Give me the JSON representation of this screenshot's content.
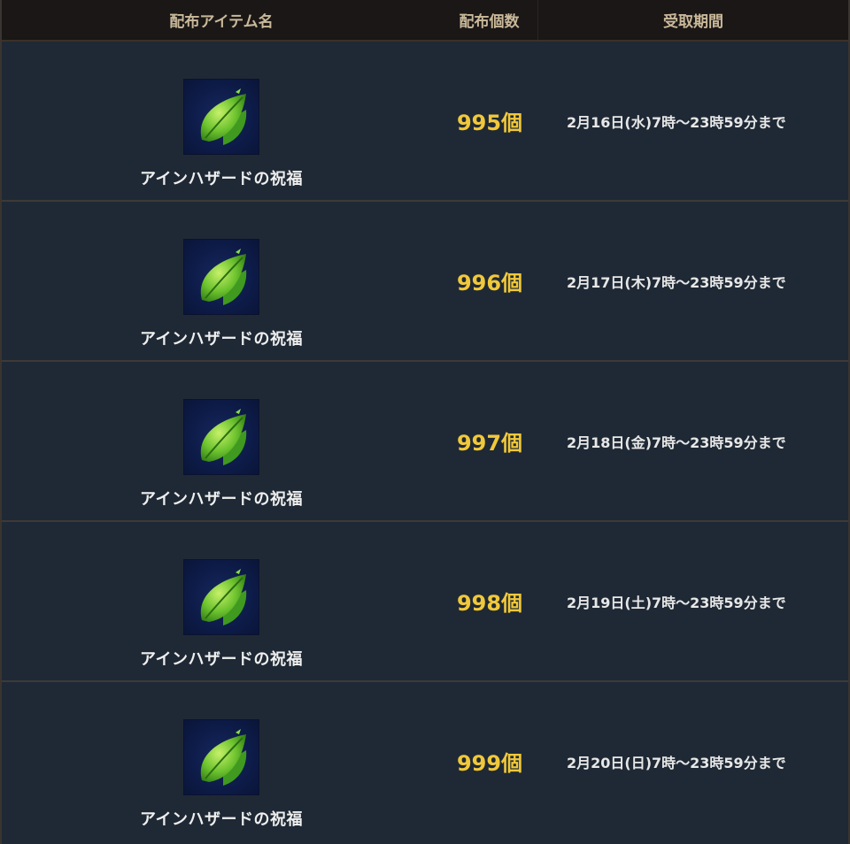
{
  "header": {
    "name_label": "配布アイテム名",
    "qty_label": "配布個数",
    "period_label": "受取期間"
  },
  "rows": [
    {
      "item_name": "アインハザードの祝福",
      "icon": "leaf-icon",
      "quantity": "995個",
      "period": "2月16日(水)7時〜23時59分まで"
    },
    {
      "item_name": "アインハザードの祝福",
      "icon": "leaf-icon",
      "quantity": "996個",
      "period": "2月17日(木)7時〜23時59分まで"
    },
    {
      "item_name": "アインハザードの祝福",
      "icon": "leaf-icon",
      "quantity": "997個",
      "period": "2月18日(金)7時〜23時59分まで"
    },
    {
      "item_name": "アインハザードの祝福",
      "icon": "leaf-icon",
      "quantity": "998個",
      "period": "2月19日(土)7時〜23時59分まで"
    },
    {
      "item_name": "アインハザードの祝福",
      "icon": "leaf-icon",
      "quantity": "999個",
      "period": "2月20日(日)7時〜23時59分まで"
    }
  ],
  "colors": {
    "header_bg": "#1a1716",
    "header_text": "#c9b89a",
    "row_bg": "#1f2935",
    "quantity_text": "#f0c83a",
    "period_text": "#e8e8e8",
    "icon_bg": "#0d1b48"
  }
}
